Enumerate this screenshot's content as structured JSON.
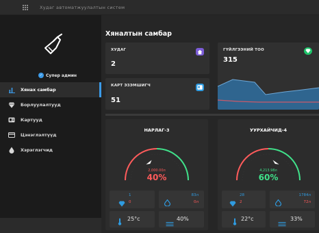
{
  "app": {
    "title": "Худаг автоматжуулалтын систем"
  },
  "user": {
    "name": "Супер админ"
  },
  "sidebar": {
    "items": [
      {
        "label": "Хянах самбар",
        "icon": "bar-chart-icon",
        "active": true
      },
      {
        "label": "Борлуулалтууд",
        "icon": "diamond-icon",
        "active": false
      },
      {
        "label": "Картууд",
        "icon": "id-card-icon",
        "active": false
      },
      {
        "label": "Цэнэглэлтүүд",
        "icon": "credit-card-icon",
        "active": false
      },
      {
        "label": "Хэрэглэгчид",
        "icon": "water-drop-icon",
        "active": false
      }
    ]
  },
  "main": {
    "title": "Хяналтын самбар",
    "stats": [
      {
        "label": "ХУДАГ",
        "value": "2",
        "icon": "home-icon",
        "color": "#7b5cd6"
      },
      {
        "label": "КАРТ ЭЗЭМШИГЧ",
        "value": "51",
        "icon": "id-card-icon",
        "color": "#2f9be0"
      },
      {
        "label": "ГҮЙЛГЭЭНИЙ ТОО",
        "value": "315",
        "icon": "diamond-icon",
        "color": "#1fc46a"
      }
    ],
    "stations": [
      {
        "name": "НАРЛАГ-3",
        "volume": "2,000.00л",
        "percent_text": "40%",
        "percent": 40,
        "color": "#ff5a5a",
        "sales": "1",
        "sales_sub": "0",
        "water": "83л",
        "water_sub": "0л",
        "temp": "25°c",
        "humidity": "40%"
      },
      {
        "name": "УУРХАЙЧИД-4",
        "volume": "4,213.98л",
        "percent_text": "60%",
        "percent": 60,
        "color": "#3fe28a",
        "sales": "28",
        "sales_sub": "2",
        "water": "1784л",
        "water_sub": "72л",
        "temp": "22°c",
        "humidity": "33%"
      }
    ]
  },
  "colors": {
    "accent": "#3b9ae8",
    "red": "#ff5a5a",
    "green": "#3fe28a",
    "area_fill": "#2f6fa0",
    "area_line": "#6ea8d8",
    "trend_line": "#c95a6a"
  }
}
